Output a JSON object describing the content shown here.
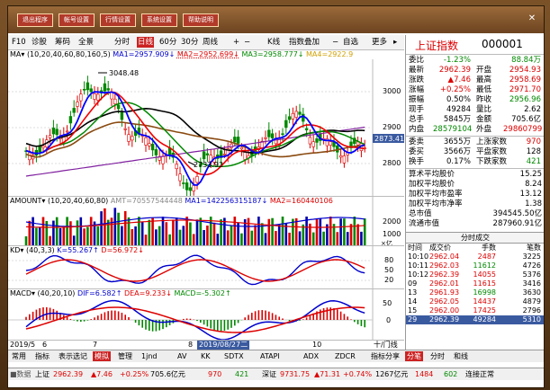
{
  "top_buttons": [
    "退出程序",
    "帐号设置",
    "行情设置",
    "系统设置",
    "帮助说明"
  ],
  "toolbar": {
    "f10": "F10",
    "diagnose": "诊股",
    "tick_chart": "筹码",
    "full": "全景",
    "min": "分时",
    "day": "日线",
    "m60": "60分",
    "m30": "30分",
    "week": "周线",
    "plus": "+",
    "minus": "−",
    "kline": "K线",
    "indicator": "指数叠加",
    "zoom_out": "−",
    "watch": "自选",
    "more": "更多",
    "scroll_l": "◂",
    "scroll_r": "▸"
  },
  "main_chart": {
    "ma_legend": [
      {
        "text": "MA▾",
        "color": "#000"
      },
      {
        "text": "(10,20,40,60,80,160,5)",
        "color": "#000"
      },
      {
        "text": "MA1=2957.909↓",
        "color": "#00c"
      },
      {
        "text": "MA2=2952.699↓",
        "color": "#d00"
      },
      {
        "text": "MA3=2958.777↓",
        "color": "#080"
      },
      {
        "text": "MA4=2922.9",
        "color": "#d0a000"
      }
    ],
    "price_axis": [
      "3000",
      "2900",
      "2800"
    ],
    "price_marker": "2873.41",
    "high_label": "3048.48",
    "low_label": "2733.92"
  },
  "amount_panel": {
    "legend": [
      {
        "text": "AMOUNT▾",
        "color": "#000"
      },
      {
        "text": "(10,20,40,60,80)",
        "color": "#000"
      },
      {
        "text": "AMT=70557544448",
        "color": "#888"
      },
      {
        "text": "MA1=142256315187↓",
        "color": "#00c"
      },
      {
        "text": "MA2=160440106",
        "color": "#d00"
      }
    ],
    "axis": [
      "2000",
      "1000"
    ],
    "unit": "×亿"
  },
  "kd_panel": {
    "legend": [
      {
        "text": "KD▾",
        "color": "#000"
      },
      {
        "text": "(40,3,3)",
        "color": "#000"
      },
      {
        "text": "K=55.267↑",
        "color": "#00c"
      },
      {
        "text": "D=56.972↓",
        "color": "#d00"
      }
    ],
    "axis": [
      "80",
      "50",
      "20"
    ]
  },
  "macd_panel": {
    "legend": [
      {
        "text": "MACD▾",
        "color": "#000"
      },
      {
        "text": "(40,20,10)",
        "color": "#000"
      },
      {
        "text": "DIF=6.582↑",
        "color": "#00c"
      },
      {
        "text": "DEA=9.233↓",
        "color": "#d00"
      },
      {
        "text": "MACD=-5.302↑",
        "color": "#080"
      }
    ],
    "axis": [
      "50",
      "0"
    ]
  },
  "date_axis": {
    "labels": [
      "2019/5",
      "6",
      "7",
      "8",
      "2019/08/27二",
      "10"
    ],
    "right": "十/门线"
  },
  "quote": {
    "name": "上证指数",
    "code": "000001",
    "rows": [
      {
        "l": "委比",
        "v": "-1.23%",
        "vc": "green",
        "l2": "",
        "v2": "88.84万",
        "v2c": "green"
      },
      {
        "l": "最新",
        "v": "2962.39",
        "vc": "red",
        "l2": "开盘",
        "v2": "2954.93",
        "v2c": "red"
      },
      {
        "l": "涨跌",
        "v": "▲7.46",
        "vc": "red",
        "l2": "最高",
        "v2": "2958.69",
        "v2c": "red"
      },
      {
        "l": "涨幅",
        "v": "+0.25%",
        "vc": "red",
        "l2": "最低",
        "v2": "2971.70",
        "v2c": "red"
      },
      {
        "l": "振幅",
        "v": "0.50%",
        "vc": "blk",
        "l2": "昨收",
        "v2": "2956.96",
        "v2c": "green"
      },
      {
        "l": "现手",
        "v": "49284",
        "vc": "blk",
        "l2": "量比",
        "v2": "2.62",
        "v2c": "blk"
      },
      {
        "l": "总手",
        "v": "5845万",
        "vc": "blk",
        "l2": "金额",
        "v2": "705.6亿",
        "v2c": "blk"
      },
      {
        "l": "内盘",
        "v": "28579104",
        "vc": "green",
        "l2": "外盘",
        "v2": "29860799",
        "v2c": "red"
      }
    ],
    "rows2": [
      {
        "l": "委卖",
        "v": "3655万",
        "vc": "blk",
        "l2": "上涨家数",
        "v2": "970",
        "v2c": "red"
      },
      {
        "l": "委买",
        "v": "3566万",
        "vc": "blk",
        "l2": "平盘家数",
        "v2": "128",
        "v2c": "blk"
      },
      {
        "l": "换手",
        "v": "0.17%",
        "vc": "blk",
        "l2": "下跌家数",
        "v2": "421",
        "v2c": "green"
      }
    ],
    "rows3": [
      {
        "l": "算术平均股价",
        "v": "15.25"
      },
      {
        "l": "加权平均股价",
        "v": "8.24"
      },
      {
        "l": "加权平均市盈率",
        "v": "13.12"
      },
      {
        "l": "加权平均市净率",
        "v": "1.38"
      },
      {
        "l": "总市值",
        "v": "394545.50亿"
      },
      {
        "l": "流通市值",
        "v": "287960.91亿"
      }
    ],
    "ticks_header": {
      "t": "时间",
      "p": "成交价",
      "v": "手数",
      "n": "笔数"
    },
    "ticks_tab": "分时成交",
    "ticks": [
      {
        "t": "10:10",
        "p": "2962.04",
        "v": "2487",
        "n": "3225"
      },
      {
        "t": "10:11",
        "p": "2962.03",
        "v": "11612",
        "n": "4726"
      },
      {
        "t": "10:12",
        "p": "2962.39",
        "v": "14055",
        "n": "5376"
      },
      {
        "t": "09",
        "p": "2962.01",
        "v": "11615",
        "n": "3416"
      },
      {
        "t": "13",
        "p": "2961.93",
        "v": "16998",
        "n": "3630"
      },
      {
        "t": "14",
        "p": "2962.05",
        "v": "14437",
        "n": "4879"
      },
      {
        "t": "15",
        "p": "2962.00",
        "v": "17425",
        "n": "2796"
      },
      {
        "t": "29",
        "p": "2962.39",
        "v": "49284",
        "n": "5310"
      }
    ]
  },
  "bottom_tabs": [
    "常用",
    "指标",
    "表示选记",
    "模拟",
    "管理",
    "1jnd",
    "AV",
    "KK",
    "SDTX",
    "ATAPI",
    "ADX",
    "ZDCR",
    "指标分享"
  ],
  "right_tabs": [
    "分笔",
    "分时",
    "和线"
  ],
  "status": [
    {
      "text": "上证",
      "color": "#000"
    },
    {
      "text": "2962.39",
      "color": "#d00"
    },
    {
      "text": "▲7.46",
      "color": "#d00"
    },
    {
      "text": "+0.25%",
      "color": "#d00"
    },
    {
      "text": "705.6亿元",
      "color": "#000"
    },
    {
      "text": "970",
      "color": "#d00"
    },
    {
      "text": "421",
      "color": "#080"
    },
    {
      "text": "深证",
      "color": "#000"
    },
    {
      "text": "9731.75",
      "color": "#d00"
    },
    {
      "text": "▲71.31",
      "color": "#d00"
    },
    {
      "text": "+0.74%",
      "color": "#d00"
    },
    {
      "text": "1267亿元",
      "color": "#000"
    },
    {
      "text": "1484",
      "color": "#d00"
    },
    {
      "text": "602",
      "color": "#080"
    },
    {
      "text": "连接正常",
      "color": "#000"
    }
  ],
  "status_left": "■数据"
}
